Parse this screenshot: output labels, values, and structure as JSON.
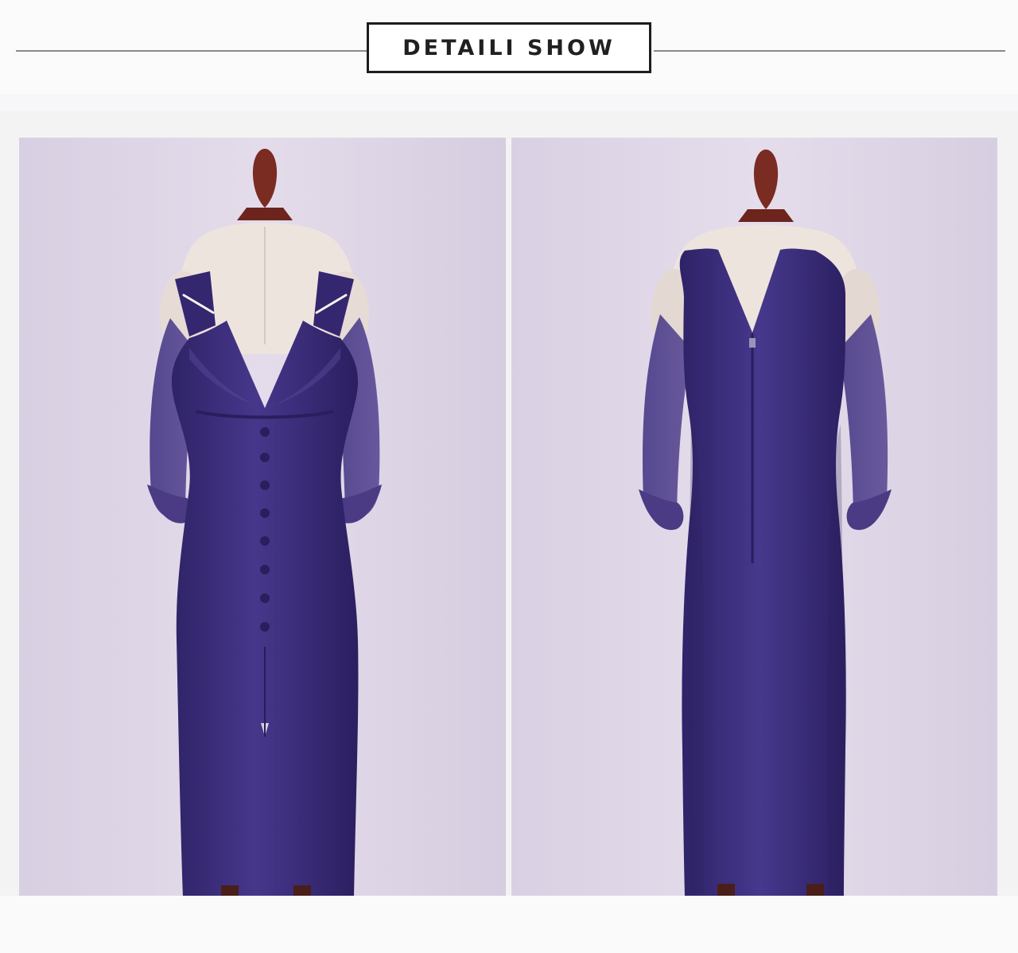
{
  "header": {
    "title": "DETAILI SHOW"
  },
  "gallery": {
    "images": [
      {
        "view": "front",
        "label": ""
      },
      {
        "view": "back",
        "label": ""
      }
    ]
  },
  "colors": {
    "dress": "#3d2d7b",
    "backdrop": "#ddd4e6",
    "mannequin": "#efe5e0",
    "stand_wood": "#7b2c22"
  }
}
